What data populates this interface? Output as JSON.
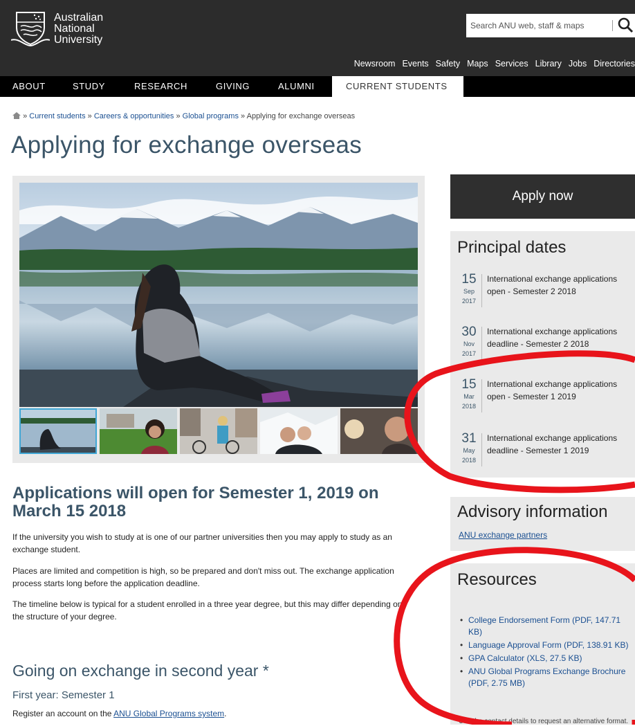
{
  "header": {
    "logo_lines": [
      "Australian",
      "National",
      "University"
    ],
    "search_placeholder": "Search ANU web, staff & maps",
    "utility_nav": [
      "Newsroom",
      "Events",
      "Safety",
      "Maps",
      "Services",
      "Library",
      "Jobs",
      "Directories"
    ]
  },
  "main_nav": [
    "ABOUT",
    "STUDY",
    "RESEARCH",
    "GIVING",
    "ALUMNI",
    "CURRENT STUDENTS"
  ],
  "main_nav_active": "CURRENT STUDENTS",
  "breadcrumb": {
    "items": [
      "Current students",
      "Careers & opportunities",
      "Global programs"
    ],
    "current": "Applying for exchange overseas",
    "separator": "»"
  },
  "page_title": "Applying for exchange overseas",
  "content": {
    "heading": "Applications will open for Semester 1, 2019 on March 15 2018",
    "paragraphs": [
      "If the university you wish to study at is one of our partner universities then you may apply to study as an exchange student.",
      "Places are limited and competition is high, so be prepared and don't miss out. The exchange application process starts long before the application deadline.",
      "The timeline below is typical for a student enrolled in a three year degree, but this may differ depending on the structure of your degree."
    ],
    "subheading": "Going on exchange in second year *",
    "step_title": "First year: Semester 1",
    "step_text_before": "Register an account on the ",
    "step_link": "ANU Global Programs system",
    "step_text_after": "."
  },
  "sidebar": {
    "apply_button": "Apply now",
    "dates_title": "Principal dates",
    "dates": [
      {
        "day": "15",
        "month": "Sep",
        "year": "2017",
        "text": "International exchange applications open - Semester 2 2018"
      },
      {
        "day": "30",
        "month": "Nov",
        "year": "2017",
        "text": "International exchange applications deadline - Semester 2 2018"
      },
      {
        "day": "15",
        "month": "Mar",
        "year": "2018",
        "text": "International exchange applications open - Semester 1 2019"
      },
      {
        "day": "31",
        "month": "May",
        "year": "2018",
        "text": "International exchange applications deadline - Semester 1 2019"
      }
    ],
    "advisory_title": "Advisory information",
    "advisory_link": "ANU exchange partners",
    "resources_title": "Resources",
    "resources": [
      "College Endorsement Form (PDF, 147.71 KB)",
      "Language Approval Form (PDF, 138.91 KB)",
      "GPA Calculator (XLS, 27.5 KB)",
      "ANU Global Programs Exchange Brochure (PDF, 2.75 MB)"
    ],
    "resources_note": "Use the contact details to request an alternative format."
  },
  "colors": {
    "header_bg": "#2c2c2c",
    "nav_bg": "#000000",
    "heading": "#3b5568",
    "link": "#1a4f91",
    "annotation": "#e8141b",
    "panel_bg": "#eaeaea"
  },
  "icons": [
    "anu-crest-logo",
    "search-icon",
    "home-icon"
  ]
}
